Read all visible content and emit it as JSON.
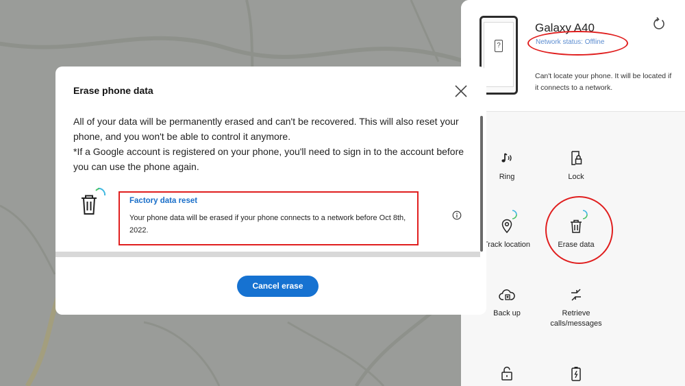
{
  "device": {
    "name": "Galaxy A40",
    "network_status": "Network status: Offline",
    "locate_note": "Can't locate your phone. It will be located if it connects to a network."
  },
  "actions": [
    {
      "label": "Ring",
      "icon": "ring-icon"
    },
    {
      "label": "Lock",
      "icon": "lock-icon"
    },
    {
      "label": "Track location",
      "icon": "track-location-icon"
    },
    {
      "label": "Erase data",
      "icon": "erase-data-icon"
    },
    {
      "label": "Back up",
      "icon": "backup-icon"
    },
    {
      "label": "Retrieve calls/messages",
      "icon": "retrieve-icon"
    },
    {
      "label": "",
      "icon": "unlock-icon"
    },
    {
      "label": "",
      "icon": "battery-icon"
    }
  ],
  "modal": {
    "title": "Erase phone data",
    "description": "All of your data will be permanently erased and can't be recovered. This will also reset your phone, and you won't be able to control it anymore.",
    "google_note": "*If a Google account is registered on your phone, you'll need to sign in to the account before you can use the phone again.",
    "reset_title": "Factory data reset",
    "reset_description": "Your phone data will be erased if your phone connects to a network before Oct 8th, 2022.",
    "cancel_label": "Cancel erase"
  },
  "colors": {
    "accent": "#1672d1",
    "link": "#1a6fc9",
    "annotation": "#e01e1e",
    "status": "#5b8cd0"
  }
}
